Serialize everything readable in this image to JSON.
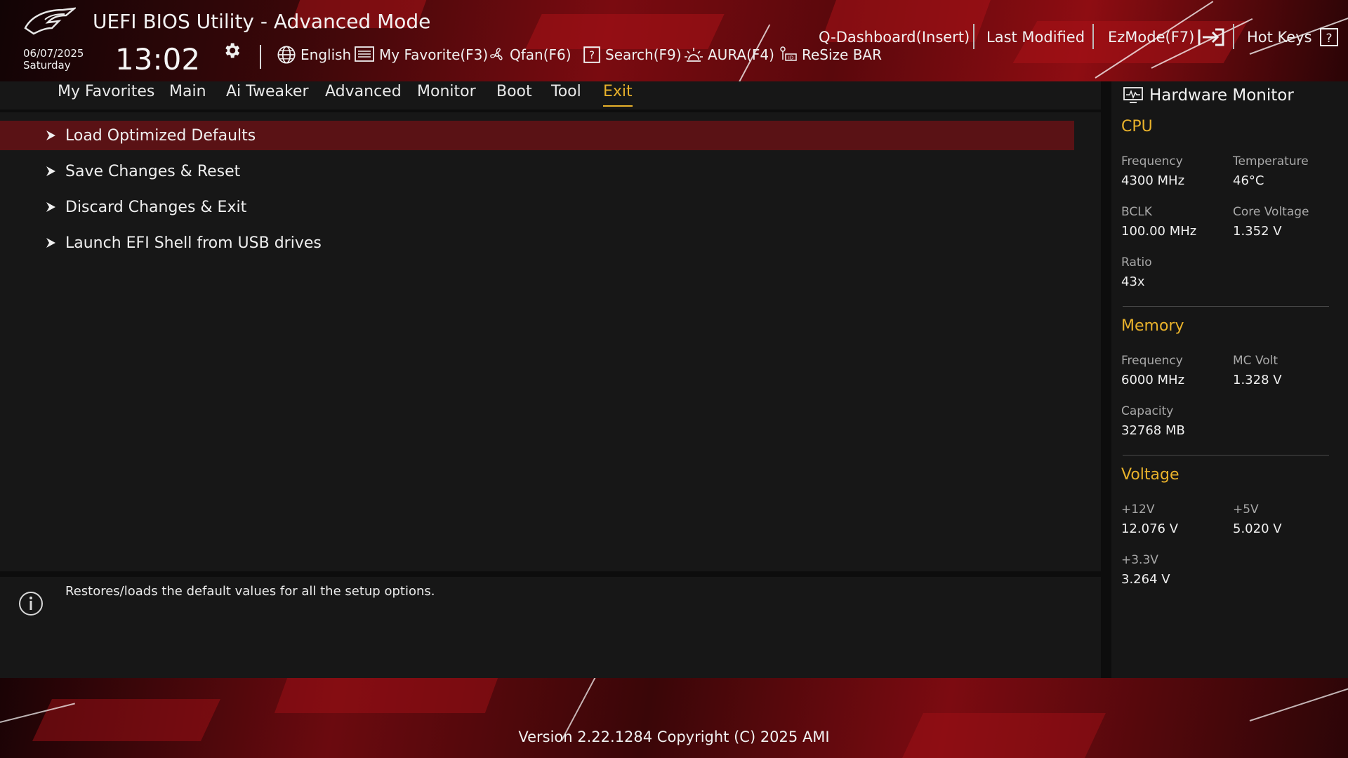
{
  "header": {
    "title": "UEFI BIOS Utility - Advanced Mode",
    "date": "06/07/2025",
    "day": "Saturday",
    "time": "13:02",
    "tools": {
      "language": "English",
      "my_favorite": "My Favorite(F3)",
      "qfan": "Qfan(F6)",
      "search": "Search(F9)",
      "aura": "AURA(F4)",
      "resize_bar": "ReSize BAR"
    }
  },
  "tabs": [
    "My Favorites",
    "Main",
    "Ai Tweaker",
    "Advanced",
    "Monitor",
    "Boot",
    "Tool",
    "Exit"
  ],
  "active_tab": "Exit",
  "menu_items": [
    "Load Optimized Defaults",
    "Save Changes & Reset",
    "Discard Changes & Exit",
    "Launch EFI Shell from USB drives"
  ],
  "help_text": "Restores/loads the default values for all the setup options.",
  "hardware_monitor": {
    "title": "Hardware Monitor",
    "cpu": {
      "title": "CPU",
      "frequency_label": "Frequency",
      "frequency": "4300 MHz",
      "temperature_label": "Temperature",
      "temperature": "46°C",
      "bclk_label": "BCLK",
      "bclk": "100.00 MHz",
      "core_voltage_label": "Core Voltage",
      "core_voltage": "1.352 V",
      "ratio_label": "Ratio",
      "ratio": "43x"
    },
    "memory": {
      "title": "Memory",
      "frequency_label": "Frequency",
      "frequency": "6000 MHz",
      "mc_volt_label": "MC Volt",
      "mc_volt": "1.328 V",
      "capacity_label": "Capacity",
      "capacity": "32768 MB"
    },
    "voltage": {
      "title": "Voltage",
      "v12_label": "+12V",
      "v12": "12.076 V",
      "v5_label": "+5V",
      "v5": "5.020 V",
      "v33_label": "+3.3V",
      "v33": "3.264 V"
    }
  },
  "footer": {
    "qdashboard": "Q-Dashboard(Insert)",
    "last_modified": "Last Modified",
    "ezmode": "EzMode(F7)",
    "hotkeys": "Hot Keys",
    "version": "Version 2.22.1284 Copyright (C) 2025 AMI"
  },
  "colors": {
    "accent": "#e9b22b",
    "selection": "#5a1215",
    "panel": "#171717"
  },
  "icons": [
    "rog-logo",
    "gear-icon",
    "globe-icon",
    "favorite-list-icon",
    "fan-icon",
    "search-help-icon",
    "aura-light-icon",
    "resize-bar-icon",
    "arrow-right-icon",
    "info-icon",
    "hardware-monitor-icon",
    "exit-arrow-icon",
    "question-icon"
  ]
}
